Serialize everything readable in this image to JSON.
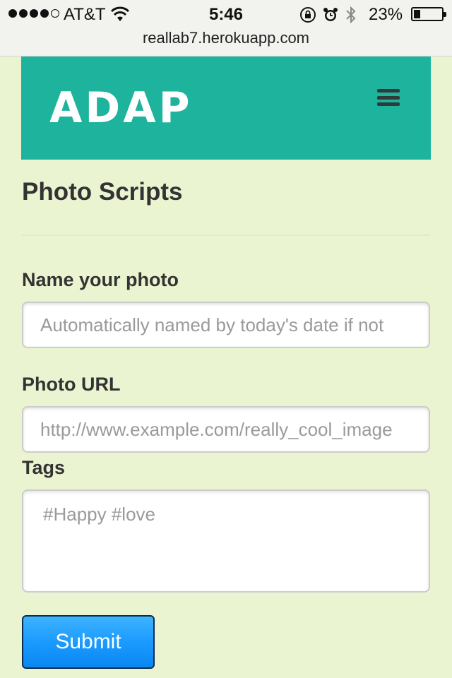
{
  "status_bar": {
    "carrier": "AT&T",
    "time": "5:46",
    "battery_percent": "23%",
    "battery_level": 0.23,
    "signal_bars_filled": 4,
    "signal_bars_total": 5,
    "icons": [
      "wifi-icon",
      "rotation-lock-icon",
      "alarm-icon",
      "bluetooth-icon",
      "battery-icon"
    ]
  },
  "browser": {
    "url": "reallab7.herokuapp.com"
  },
  "header": {
    "logo_text": "ADAP",
    "menu_icon": "hamburger-menu-icon",
    "background_color": "#1db39c"
  },
  "main": {
    "title": "Photo Scripts",
    "form": {
      "name_label": "Name your photo",
      "name_placeholder": "Automatically named by today's date if not",
      "url_label": "Photo URL",
      "url_placeholder": "http://www.example.com/really_cool_image",
      "tags_label": "Tags",
      "tags_placeholder": "#Happy #love",
      "submit_label": "Submit"
    }
  },
  "colors": {
    "page_background": "#ebf4d0",
    "accent": "#1db39c",
    "button": "#1a9bff"
  }
}
